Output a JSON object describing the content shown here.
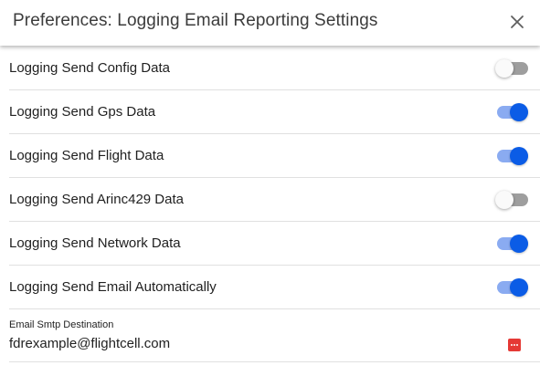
{
  "dialog": {
    "title": "Preferences: Logging Email Reporting Settings"
  },
  "settings": [
    {
      "label": "Logging Send Config Data",
      "enabled": false
    },
    {
      "label": "Logging Send Gps Data",
      "enabled": true
    },
    {
      "label": "Logging Send Flight Data",
      "enabled": true
    },
    {
      "label": "Logging Send Arinc429 Data",
      "enabled": false
    },
    {
      "label": "Logging Send Network Data",
      "enabled": true
    },
    {
      "label": "Logging Send Email Automatically",
      "enabled": true
    }
  ],
  "email_field": {
    "label": "Email Smtp Destination",
    "value": "fdrexample@flightcell.com"
  },
  "colors": {
    "toggle_on_thumb": "#0b5ce6",
    "toggle_on_track": "#8aabf1",
    "toggle_off_track": "#9e9e9e",
    "password_manager_icon": "#e53935"
  },
  "icons": {
    "close": "close-icon",
    "password_manager": "password-manager-icon"
  }
}
